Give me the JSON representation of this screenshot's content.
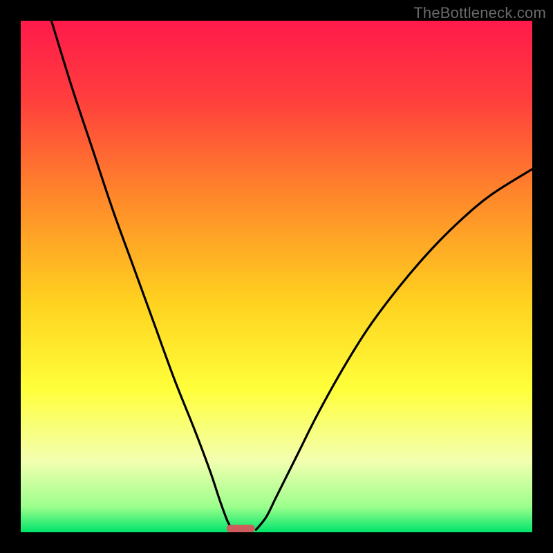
{
  "watermark": "TheBottleneck.com",
  "chart_data": {
    "type": "line",
    "title": "",
    "xlabel": "",
    "ylabel": "",
    "xlim": [
      0,
      100
    ],
    "ylim": [
      0,
      100
    ],
    "grid": false,
    "legend": false,
    "background": {
      "description": "Vertical gradient from red through orange/yellow to green, indicating severity from top (bad) to bottom (good).",
      "stops": [
        {
          "pos": 0.0,
          "color": "#ff1a4b"
        },
        {
          "pos": 0.15,
          "color": "#ff3d3d"
        },
        {
          "pos": 0.35,
          "color": "#ff8a2a"
        },
        {
          "pos": 0.55,
          "color": "#ffd21f"
        },
        {
          "pos": 0.72,
          "color": "#ffff3a"
        },
        {
          "pos": 0.86,
          "color": "#f3ffb0"
        },
        {
          "pos": 0.95,
          "color": "#9cff8c"
        },
        {
          "pos": 1.0,
          "color": "#00e46a"
        }
      ]
    },
    "series": [
      {
        "name": "left-branch",
        "description": "Descending concave curve from upper-left toward the minimum marker near x≈40.",
        "x": [
          6,
          10,
          14,
          18,
          22,
          26,
          30,
          34,
          37,
          39,
          40.5,
          41.5
        ],
        "y": [
          100,
          87,
          75,
          63,
          52,
          41,
          30,
          20,
          12,
          6,
          2,
          0.5
        ]
      },
      {
        "name": "right-branch",
        "description": "Ascending concave curve from the minimum marker toward the upper-right, ending around y≈70 at x=100.",
        "x": [
          46,
          48,
          50,
          54,
          58,
          63,
          68,
          74,
          80,
          86,
          92,
          100
        ],
        "y": [
          0.5,
          3,
          7,
          15,
          23,
          32,
          40,
          48,
          55,
          61,
          66,
          71
        ]
      }
    ],
    "marker": {
      "description": "Small rounded horizontal bar at the valley floor indicating the optimal/minimum region.",
      "x_center": 43,
      "width": 5.5,
      "y": 0.8,
      "color": "#cd5c5c"
    }
  }
}
